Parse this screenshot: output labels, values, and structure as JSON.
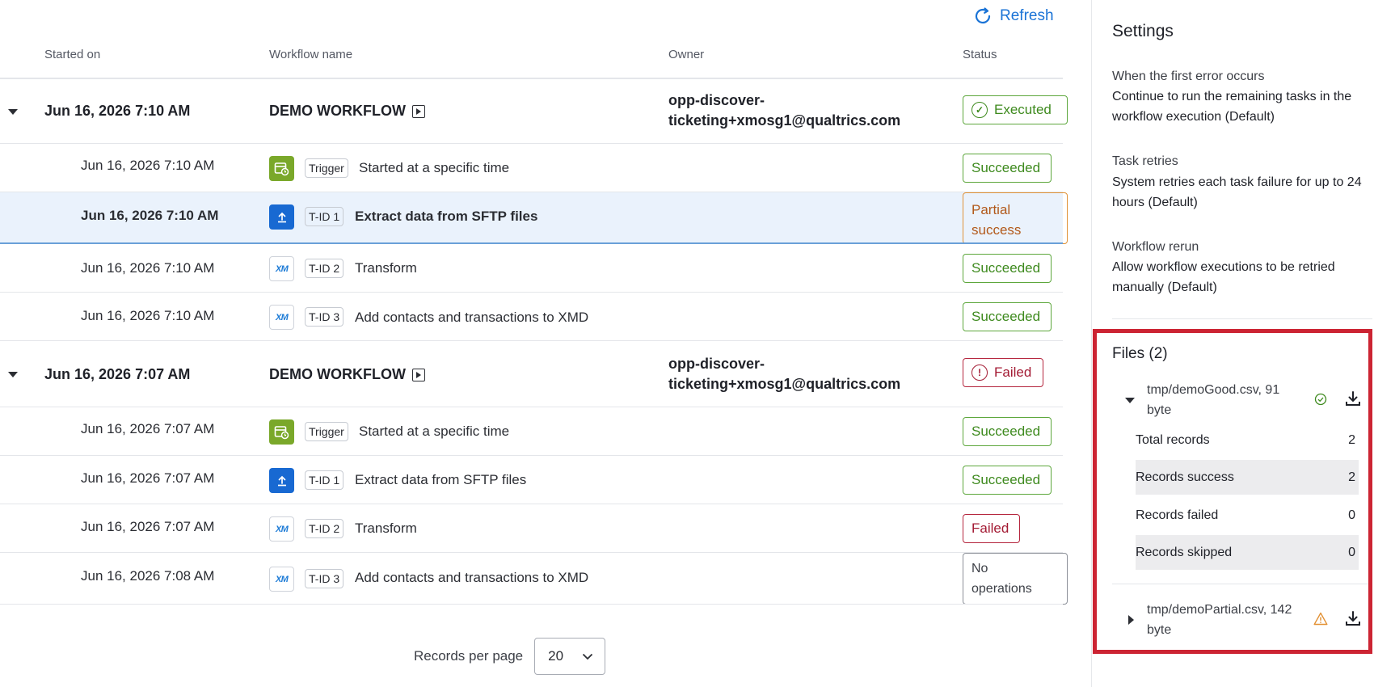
{
  "toolbar": {
    "refresh_label": "Refresh"
  },
  "columns": {
    "started_on": "Started on",
    "workflow_name": "Workflow name",
    "owner": "Owner",
    "status": "Status"
  },
  "executions": [
    {
      "date": "Jun 16, 2026 7:10 AM",
      "workflow": "DEMO WORKFLOW",
      "owner_line1": "opp-discover-",
      "owner_line2": "ticketing+xmosg1@qualtrics.com",
      "status": "Executed",
      "tasks": [
        {
          "date": "Jun 16, 2026 7:10 AM",
          "icon": "calendar-clock-icon",
          "tag": "Trigger",
          "name": "Started at a specific time",
          "status": "Succeeded"
        },
        {
          "date": "Jun 16, 2026 7:10 AM",
          "icon": "upload-icon",
          "tag": "T-ID 1",
          "name": "Extract data from SFTP files",
          "status_line1": "Partial",
          "status_line2": "success"
        },
        {
          "date": "Jun 16, 2026 7:10 AM",
          "icon": "xm-icon",
          "icon_text": "XM",
          "tag": "T-ID 2",
          "name": "Transform",
          "status": "Succeeded"
        },
        {
          "date": "Jun 16, 2026 7:10 AM",
          "icon": "xm-icon",
          "icon_text": "XM",
          "tag": "T-ID 3",
          "name": "Add contacts and transactions to XMD",
          "status": "Succeeded"
        }
      ]
    },
    {
      "date": "Jun 16, 2026 7:07 AM",
      "workflow": "DEMO WORKFLOW",
      "owner_line1": "opp-discover-",
      "owner_line2": "ticketing+xmosg1@qualtrics.com",
      "status": "Failed",
      "tasks": [
        {
          "date": "Jun 16, 2026 7:07 AM",
          "icon": "calendar-clock-icon",
          "tag": "Trigger",
          "name": "Started at a specific time",
          "status": "Succeeded"
        },
        {
          "date": "Jun 16, 2026 7:07 AM",
          "icon": "upload-icon",
          "tag": "T-ID 1",
          "name": "Extract data from SFTP files",
          "status": "Succeeded"
        },
        {
          "date": "Jun 16, 2026 7:07 AM",
          "icon": "xm-icon",
          "icon_text": "XM",
          "tag": "T-ID 2",
          "name": "Transform",
          "status": "Failed"
        },
        {
          "date": "Jun 16, 2026 7:08 AM",
          "icon": "xm-icon",
          "icon_text": "XM",
          "tag": "T-ID 3",
          "name": "Add contacts and transactions to XMD",
          "status_line1": "No",
          "status_line2": "operations"
        }
      ]
    }
  ],
  "pagination": {
    "label": "Records per page",
    "value": "20"
  },
  "settings": {
    "title": "Settings",
    "items": [
      {
        "label": "When the first error occurs",
        "value": "Continue to run the remaining tasks in the workflow execution (Default)"
      },
      {
        "label": "Task retries",
        "value": "System retries each task failure for up to 24 hours (Default)"
      },
      {
        "label": "Workflow rerun",
        "value": "Allow workflow executions to be retried manually (Default)"
      }
    ]
  },
  "files": {
    "title": "Files (2)",
    "items": [
      {
        "name_line1": "tmp/demoGood.csv, 91",
        "name_line2": "byte",
        "status_icon": "check-circle-icon",
        "expanded": true,
        "stats": [
          {
            "label": "Total records",
            "value": "2"
          },
          {
            "label": "Records success",
            "value": "2"
          },
          {
            "label": "Records failed",
            "value": "0"
          },
          {
            "label": "Records skipped",
            "value": "0"
          }
        ]
      },
      {
        "name_line1": "tmp/demoPartial.csv, 142",
        "name_line2": "byte",
        "status_icon": "warning-icon",
        "expanded": false
      }
    ]
  },
  "colors": {
    "accent": "#1a73d6",
    "success": "#3e8a1e",
    "failure": "#a31a33",
    "partial": "#b2591a",
    "highlight_box": "#cc2433"
  }
}
